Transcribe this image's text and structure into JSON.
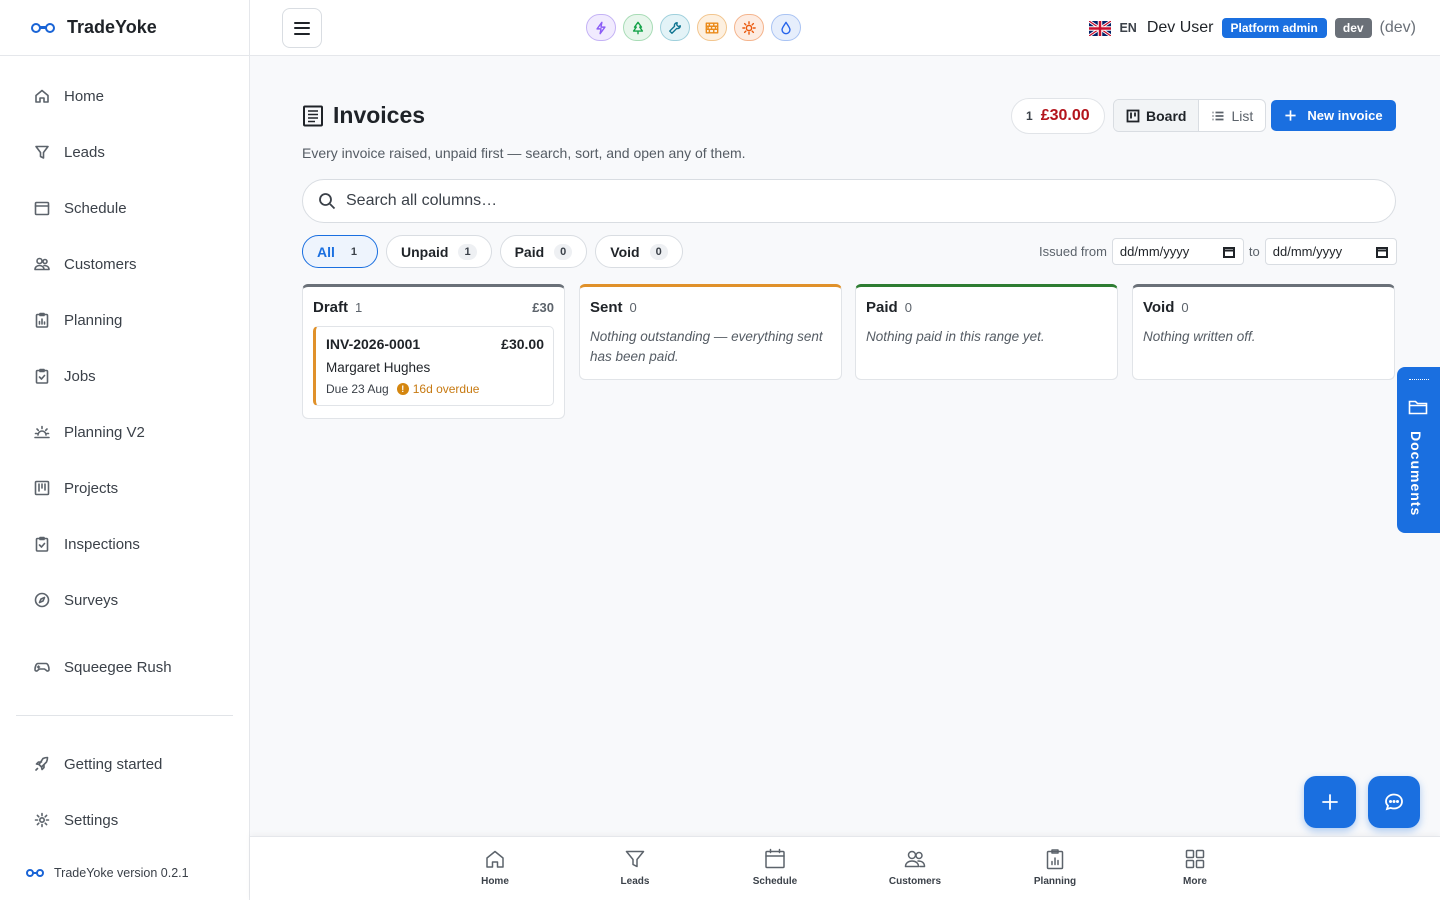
{
  "app": {
    "name": "TradeYoke",
    "version_text": "TradeYoke version 0.2.1"
  },
  "sidebar": {
    "items": [
      {
        "label": "Home",
        "icon": "home-icon"
      },
      {
        "label": "Leads",
        "icon": "filter-icon"
      },
      {
        "label": "Schedule",
        "icon": "calendar-icon"
      },
      {
        "label": "Customers",
        "icon": "users-icon"
      },
      {
        "label": "Planning",
        "icon": "clipboard-chart-icon"
      },
      {
        "label": "Jobs",
        "icon": "clipboard-check-icon"
      },
      {
        "label": "Planning V2",
        "icon": "sunrise-icon"
      },
      {
        "label": "Projects",
        "icon": "kanban-icon"
      },
      {
        "label": "Inspections",
        "icon": "clipboard-check-icon"
      },
      {
        "label": "Surveys",
        "icon": "compass-icon"
      },
      {
        "label": "Squeegee Rush",
        "icon": "gamepad-icon"
      }
    ],
    "footer_items": [
      {
        "label": "Getting started",
        "icon": "rocket-icon"
      },
      {
        "label": "Settings",
        "icon": "gear-icon"
      }
    ]
  },
  "topbar": {
    "trade_icons": [
      {
        "name": "electrical-icon",
        "color": "#8b5cf6",
        "bg": "#f1ebfe"
      },
      {
        "name": "tree-icon",
        "color": "#16a34a",
        "bg": "#e8f6ec"
      },
      {
        "name": "wrench-icon",
        "color": "#0e7490",
        "bg": "#e3f3f7"
      },
      {
        "name": "brick-icon",
        "color": "#ea8a1a",
        "bg": "#fdf0e0"
      },
      {
        "name": "sun-icon",
        "color": "#ea580c",
        "bg": "#fdece2"
      },
      {
        "name": "water-drop-icon",
        "color": "#2563eb",
        "bg": "#e6eefc"
      }
    ],
    "language": "EN",
    "user_name": "Dev User",
    "role_badge": "Platform admin",
    "env_badge": "dev",
    "env_label": "(dev)"
  },
  "page": {
    "title": "Invoices",
    "subtitle": "Every invoice raised, unpaid first — search, sort, and open any of them.",
    "outstanding_count": "1",
    "outstanding_amount": "£30.00",
    "view_board": "Board",
    "view_list": "List",
    "new_button": "New invoice",
    "search_placeholder": "Search all columns…"
  },
  "filters": {
    "chips": [
      {
        "label": "All",
        "count": "1"
      },
      {
        "label": "Unpaid",
        "count": "1"
      },
      {
        "label": "Paid",
        "count": "0"
      },
      {
        "label": "Void",
        "count": "0"
      }
    ],
    "issued_from_label": "Issued from",
    "date_from": "dd/mm/yyyy",
    "to_label": "to",
    "date_to": "dd/mm/yyyy"
  },
  "board": {
    "columns": [
      {
        "title": "Draft",
        "count": "1",
        "sum": "£30",
        "accent": "#6a7078"
      },
      {
        "title": "Sent",
        "count": "0",
        "empty": "Nothing outstanding — everything sent has been paid.",
        "accent": "#e0912a"
      },
      {
        "title": "Paid",
        "count": "0",
        "empty": "Nothing paid in this range yet.",
        "accent": "#2e7d32"
      },
      {
        "title": "Void",
        "count": "0",
        "empty": "Nothing written off.",
        "accent": "#6a7078"
      }
    ],
    "draft_card": {
      "number": "INV-2026-0001",
      "amount": "£30.00",
      "customer": "Margaret Hughes",
      "due": "Due 23 Aug",
      "overdue": "16d overdue"
    }
  },
  "documents_tab": "Documents",
  "bottom_nav": [
    {
      "label": "Home",
      "icon": "home-icon"
    },
    {
      "label": "Leads",
      "icon": "filter-icon"
    },
    {
      "label": "Schedule",
      "icon": "calendar-icon"
    },
    {
      "label": "Customers",
      "icon": "users-icon"
    },
    {
      "label": "Planning",
      "icon": "clipboard-chart-icon"
    },
    {
      "label": "More",
      "icon": "grid-icon"
    }
  ]
}
